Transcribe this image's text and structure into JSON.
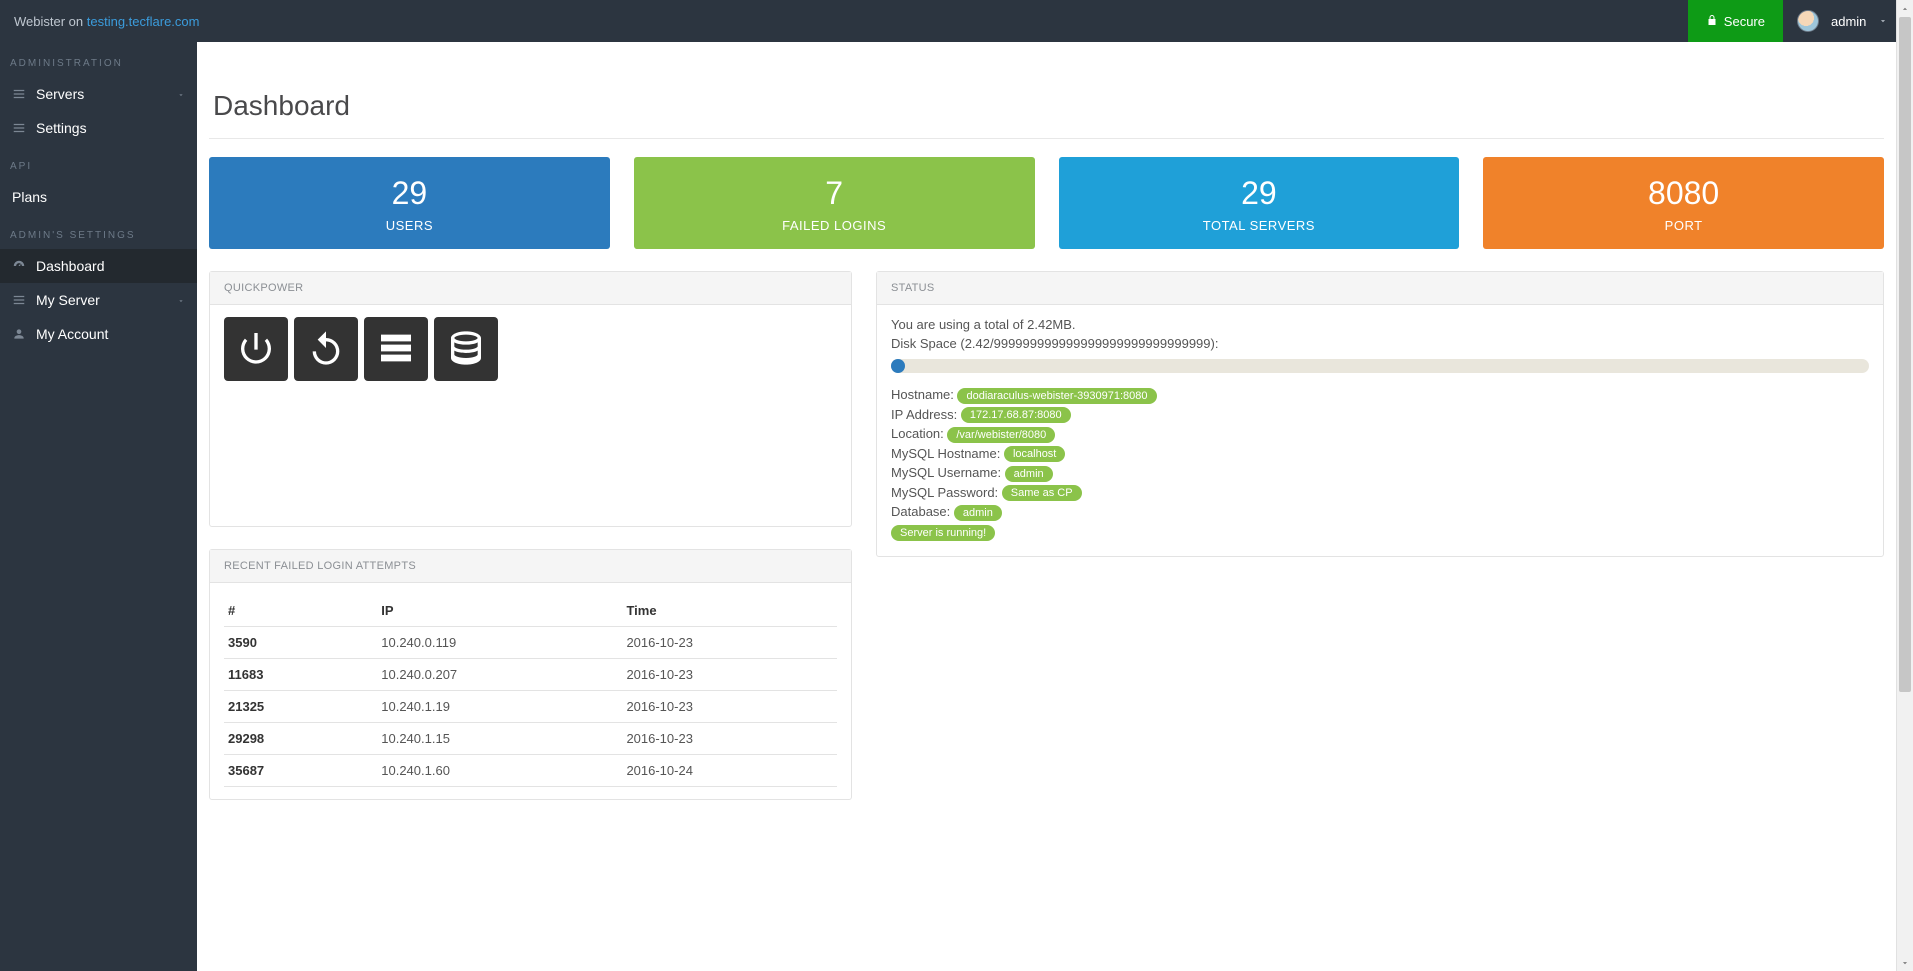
{
  "topbar": {
    "brand_prefix": "Webister on ",
    "brand_host": "testing.tecflare.com",
    "secure_label": "Secure",
    "user_name": "admin"
  },
  "sidebar": {
    "section1": "ADMINISTRATION",
    "servers": "Servers",
    "settings": "Settings",
    "section2": "API",
    "plans": "Plans",
    "section3": "ADMIN'S SETTINGS",
    "dashboard": "Dashboard",
    "my_server": "My Server",
    "my_account": "My Account"
  },
  "page": {
    "title": "Dashboard"
  },
  "stats": {
    "users": {
      "value": "29",
      "label": "USERS"
    },
    "failed_logins": {
      "value": "7",
      "label": "FAILED LOGINS"
    },
    "total_servers": {
      "value": "29",
      "label": "TOTAL SERVERS"
    },
    "port": {
      "value": "8080",
      "label": "PORT"
    }
  },
  "quickpower": {
    "title": "QUICKPOWER"
  },
  "status": {
    "title": "STATUS",
    "usage_line": "You are using a total of 2.42MB.",
    "disk_line": "Disk Space (2.42/999999999999999999999999999999):",
    "hostname_label": "Hostname: ",
    "hostname_value": "dodiaraculus-webister-3930971:8080",
    "ip_label": "IP Address: ",
    "ip_value": "172.17.68.87:8080",
    "loc_label": "Location: ",
    "loc_value": "/var/webister/8080",
    "mysql_host_label": "MySQL Hostname: ",
    "mysql_host_value": "localhost",
    "mysql_user_label": "MySQL Username: ",
    "mysql_user_value": "admin",
    "mysql_pass_label": "MySQL Password: ",
    "mysql_pass_value": "Same as CP",
    "db_label": "Database: ",
    "db_value": "admin",
    "running_value": "Server is running!"
  },
  "failed": {
    "title": "RECENT FAILED LOGIN ATTEMPTS",
    "headers": {
      "num": "#",
      "ip": "IP",
      "time": "Time"
    },
    "rows": [
      {
        "id": "3590",
        "ip": "10.240.0.119",
        "time": "2016-10-23"
      },
      {
        "id": "11683",
        "ip": "10.240.0.207",
        "time": "2016-10-23"
      },
      {
        "id": "21325",
        "ip": "10.240.1.19",
        "time": "2016-10-23"
      },
      {
        "id": "29298",
        "ip": "10.240.1.15",
        "time": "2016-10-23"
      },
      {
        "id": "35687",
        "ip": "10.240.1.60",
        "time": "2016-10-24"
      }
    ]
  }
}
